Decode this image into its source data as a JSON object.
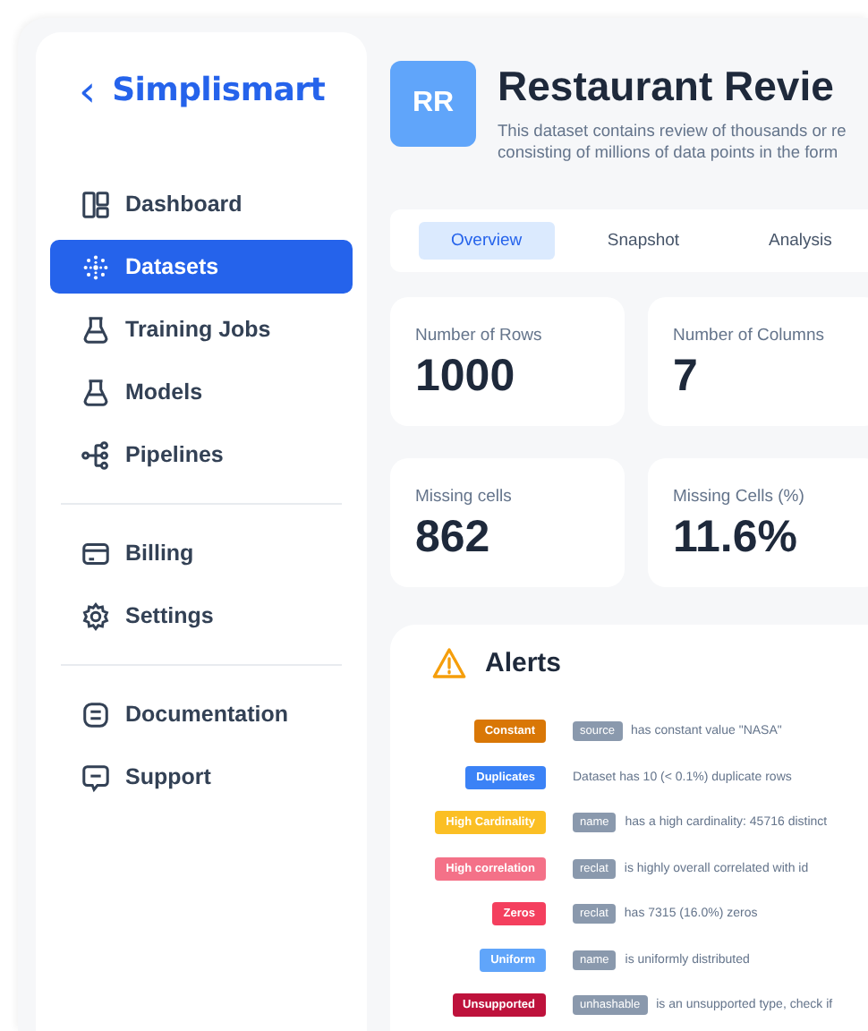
{
  "sidebar": {
    "back_icon": "‹",
    "brand": "Simplismart",
    "groups": [
      [
        {
          "label": "Dashboard",
          "selected": false
        },
        {
          "label": "Datasets",
          "selected": true
        },
        {
          "label": "Training Jobs",
          "selected": false
        },
        {
          "label": "Models",
          "selected": false
        },
        {
          "label": "Pipelines",
          "selected": false
        }
      ],
      [
        {
          "label": "Billing",
          "selected": false
        },
        {
          "label": "Settings",
          "selected": false
        }
      ],
      [
        {
          "label": "Documentation",
          "selected": false
        },
        {
          "label": "Support",
          "selected": false
        }
      ]
    ]
  },
  "header": {
    "avatar": "RR",
    "title": "Restaurant Revie",
    "description": [
      "This dataset contains review of thousands or re",
      "consisting of millions of data points in the form"
    ]
  },
  "tabs": [
    {
      "label": "Overview",
      "selected": true
    },
    {
      "label": "Snapshot",
      "selected": false
    },
    {
      "label": "Analysis",
      "selected": false
    }
  ],
  "stats": [
    {
      "label": "Number of Rows",
      "value": "1000"
    },
    {
      "label": "Number of Columns",
      "value": "7"
    },
    {
      "label": "Missing cells",
      "value": "862"
    },
    {
      "label": "Missing Cells (%)",
      "value": "11.6%"
    }
  ],
  "alerts": {
    "title": "Alerts",
    "items": [
      {
        "badge": "Constant",
        "color": "#d97706",
        "column": "source",
        "message": "has constant value \"NASA\""
      },
      {
        "badge": "Duplicates",
        "color": "#3b82f6",
        "message": "Dataset has 10 (< 0.1%) duplicate rows"
      },
      {
        "badge": "High Cardinality",
        "color": "#fbbf24",
        "column": "name",
        "message": "has a high cardinality: 45716 distinct"
      },
      {
        "badge": "High correlation",
        "color": "#f47188",
        "column": "reclat",
        "message": "is highly overall correlated with id"
      },
      {
        "badge": "Zeros",
        "color": "#f43f5e",
        "column": "reclat",
        "message": "has 7315 (16.0%) zeros"
      },
      {
        "badge": "Uniform",
        "color": "#60a5fa",
        "column": "name",
        "message": "is uniformly distributed"
      },
      {
        "badge": "Unsupported",
        "color": "#be123c",
        "column": "unhashable",
        "message": "is an unsupported type, check if"
      }
    ]
  }
}
